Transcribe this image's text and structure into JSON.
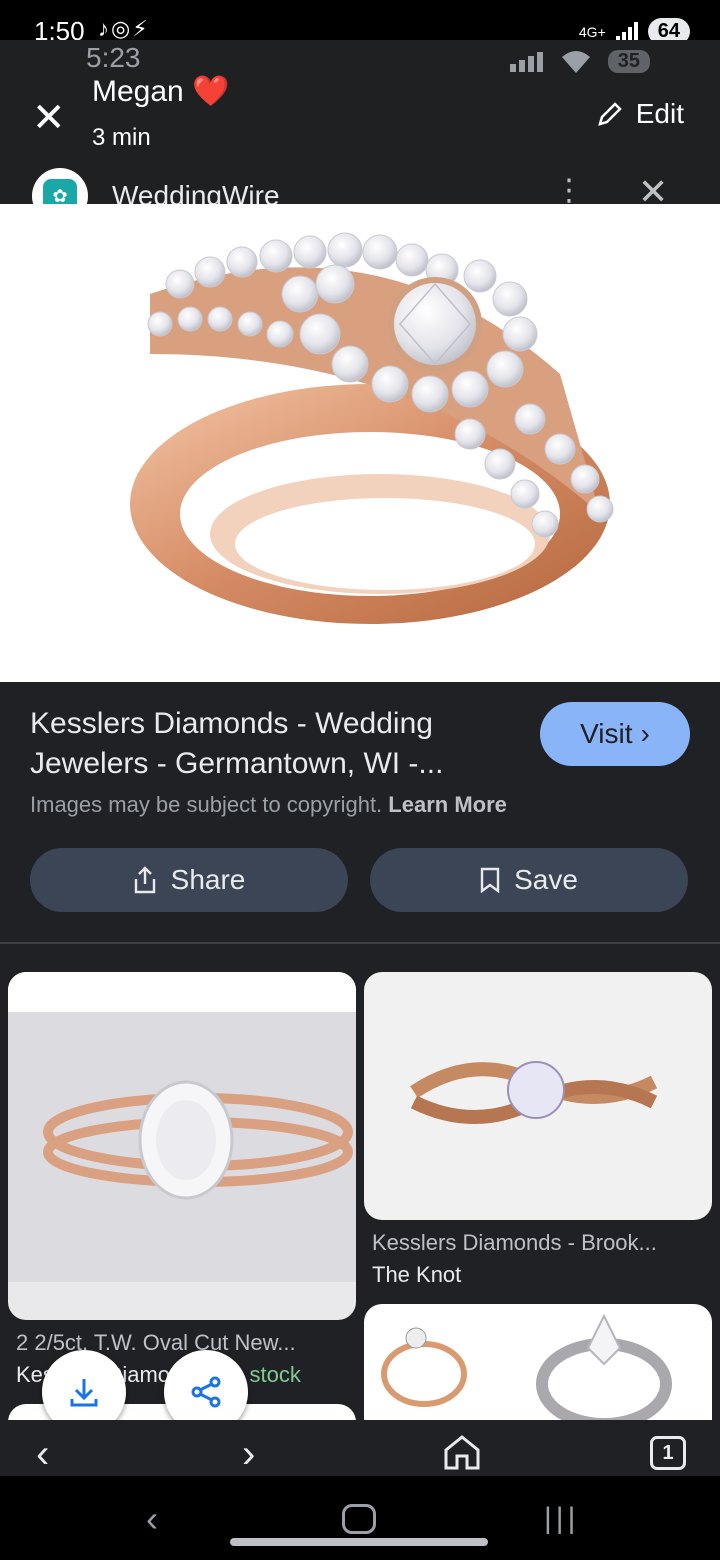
{
  "status_bar": {
    "time": "1:50",
    "network": "4G+",
    "battery": "64"
  },
  "story_overlay": {
    "time": "5:23",
    "battery": "35",
    "contact_name": "Megan",
    "heart": "❤️",
    "duration": "3 min",
    "edit_label": "Edit"
  },
  "source": {
    "name": "WeddingWire"
  },
  "result": {
    "title": "Kesslers Diamonds - Wedding Jewelers - Germantown, WI -...",
    "visit_label": "Visit",
    "copyright_text": "Images may be subject to copyright.",
    "learn_more": "Learn More",
    "share_label": "Share",
    "save_label": "Save"
  },
  "related": [
    {
      "title": "2 2/5ct. T.W. Oval Cut New...",
      "source": "Kesslers Diamonds",
      "stock": "In stock"
    },
    {
      "title": "Kesslers Diamonds - Brook...",
      "source": "The Knot"
    }
  ],
  "browser_bar": {
    "tab_count": "1"
  }
}
